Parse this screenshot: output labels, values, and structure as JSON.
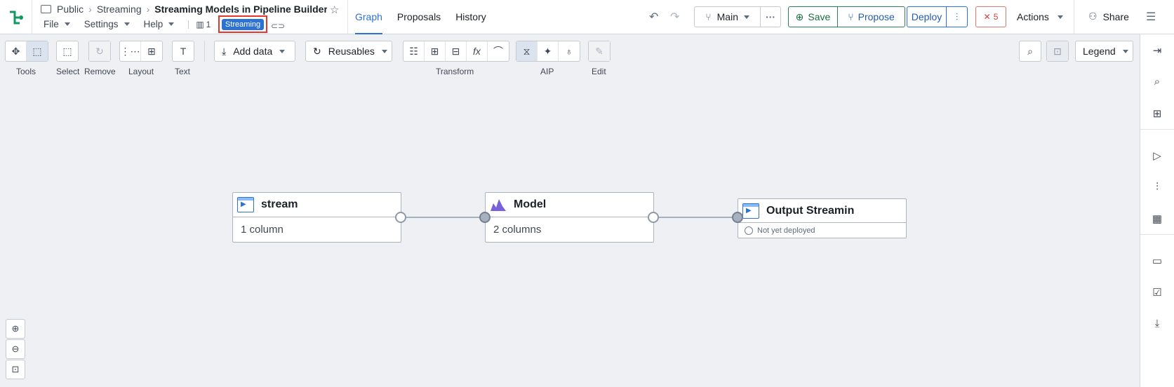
{
  "header": {
    "breadcrumbs": [
      "Public",
      "Streaming"
    ],
    "title": "Streaming Models in Pipeline Builder E...",
    "menus": [
      "File",
      "Settings",
      "Help"
    ],
    "count": "1",
    "mode_tag": "Streaming",
    "tabs": [
      "Graph",
      "Proposals",
      "History"
    ],
    "branch": "Main",
    "save": "Save",
    "propose": "Propose",
    "deploy": "Deploy",
    "errors": "5",
    "actions": "Actions",
    "share": "Share"
  },
  "toolbar": {
    "add_data": "Add data",
    "reusables": "Reusables",
    "legend": "Legend",
    "labels": {
      "tools": "Tools",
      "select": "Select",
      "remove": "Remove",
      "layout": "Layout",
      "text": "Text",
      "transform": "Transform",
      "aip": "AIP",
      "edit": "Edit"
    }
  },
  "graph": {
    "nodes": [
      {
        "name": "stream",
        "detail": "1 column"
      },
      {
        "name": "Model",
        "detail": "2 columns"
      },
      {
        "name": "Output Streamin",
        "detail": "Not yet deployed"
      }
    ]
  },
  "colors": {
    "accent": "#2d72d2",
    "save_green": "#238551",
    "error_red": "#cd4246",
    "highlight_box": "#e8352a"
  },
  "icons": {
    "right_sidebar": [
      "exit-icon",
      "search-icon",
      "nodes-icon",
      "play-icon",
      "sliders-icon",
      "table-icon",
      "folder-icon",
      "checklist-icon",
      "download-icon"
    ]
  }
}
